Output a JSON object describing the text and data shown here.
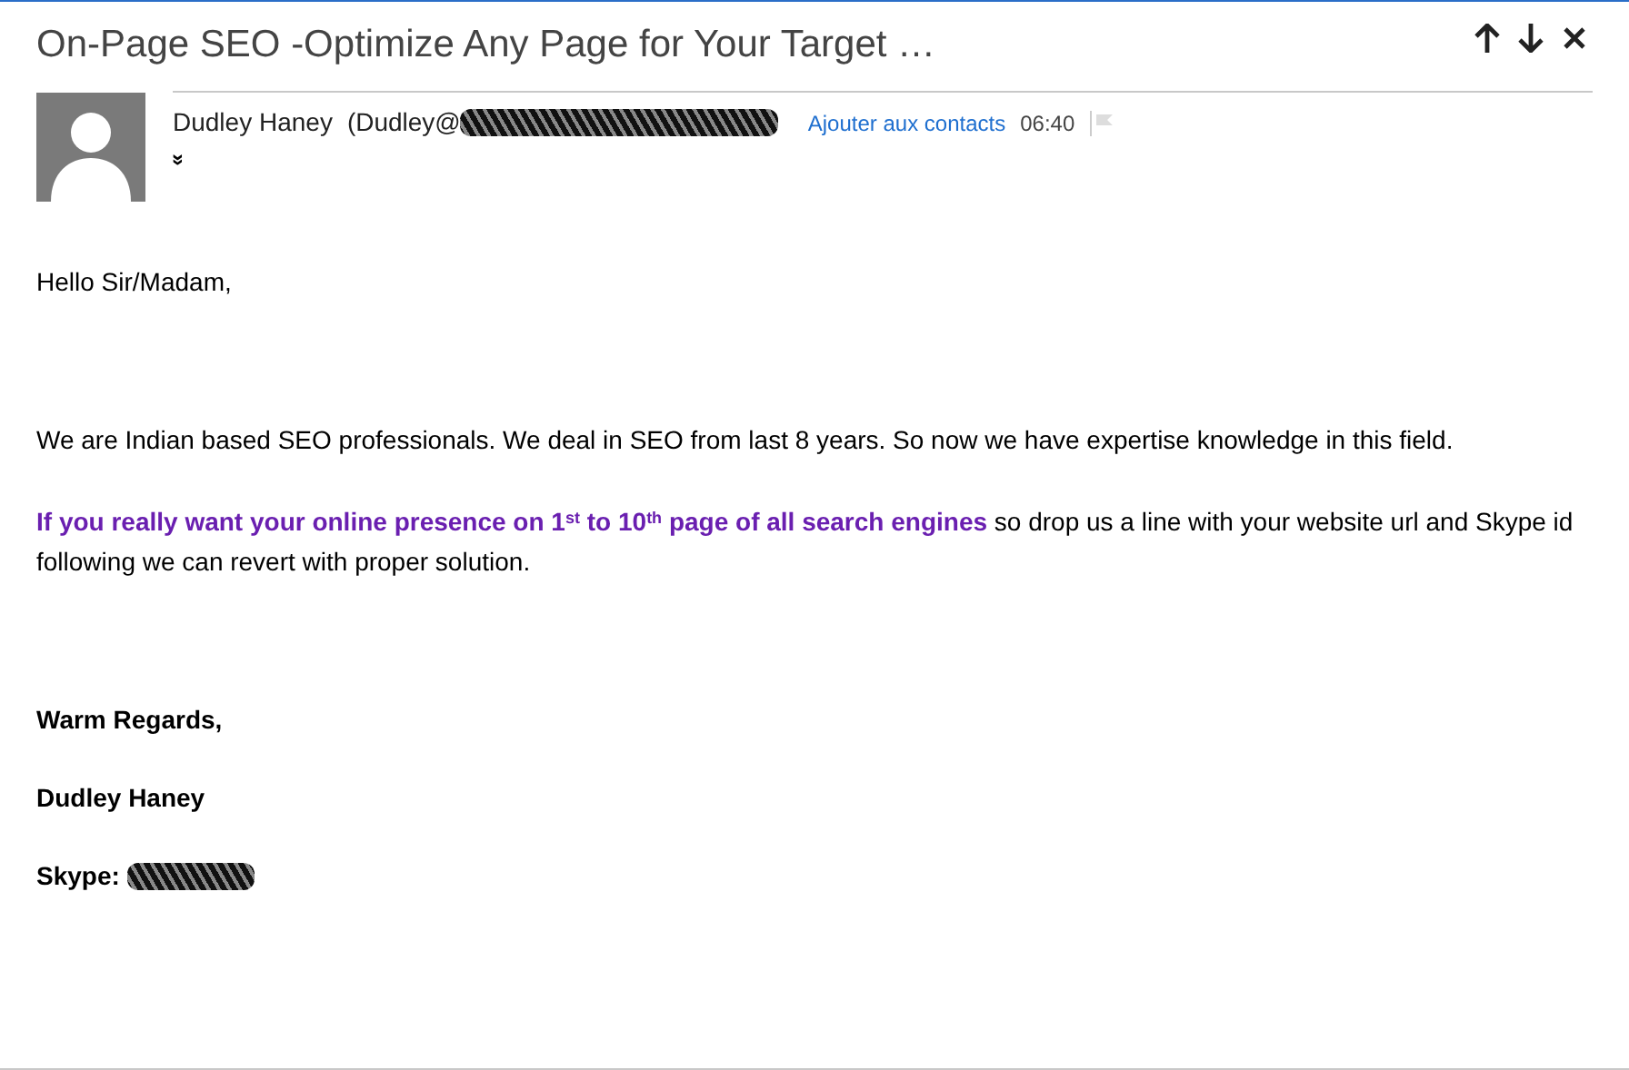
{
  "header": {
    "title": "On-Page SEO -Optimize Any Page for Your Target …"
  },
  "sender": {
    "name": "Dudley Haney",
    "address": "(Dudley@",
    "add_contact": "Ajouter aux contacts",
    "time": "06:40",
    "flagged": false,
    "expand": "»"
  },
  "body": {
    "greeting": "Hello Sir/Madam,",
    "paragraphs": [
      "We are Indian based SEO professionals. We deal in SEO from last 8 years. So now we have expertise knowledge in this field.",
      "**If you really want your online presence on 1$^{st}$ to 10$^{th}$ page of all search engines** so drop us a line with your  website url and Skype id following we can revert with proper solution."
    ],
    "closing": "Warm Regards,",
    "signature": "Dudley Haney",
    "skype_label": "Skype:"
  }
}
